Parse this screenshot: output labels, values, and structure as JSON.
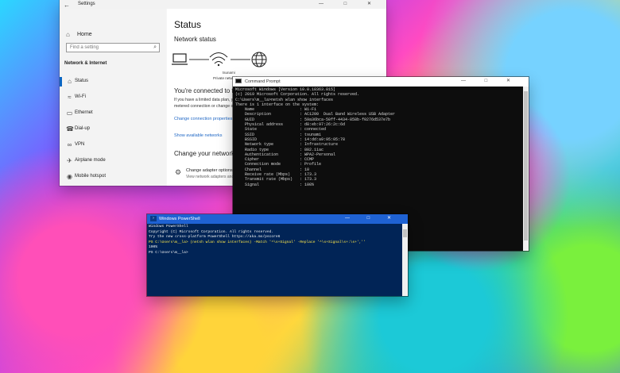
{
  "settings": {
    "window_title": "Settings",
    "back_glyph": "←",
    "controls": [
      "—",
      "□",
      "✕"
    ],
    "home_label": "Home",
    "search_placeholder": "Find a setting",
    "section_title": "Network & Internet",
    "nav_items": [
      {
        "label": "Status",
        "icon": "home-network-icon"
      },
      {
        "label": "Wi-Fi",
        "icon": "wifi-icon"
      },
      {
        "label": "Ethernet",
        "icon": "ethernet-icon"
      },
      {
        "label": "Dial-up",
        "icon": "phone-icon"
      },
      {
        "label": "VPN",
        "icon": "vpn-icon"
      },
      {
        "label": "Airplane mode",
        "icon": "airplane-icon"
      },
      {
        "label": "Mobile hotspot",
        "icon": "hotspot-icon"
      }
    ],
    "main": {
      "title": "Status",
      "network_status": "Network status",
      "network_name": "tsunami",
      "network_type": "Private network",
      "connected_text": "You're connected to the Internet",
      "limited_text": "If you have a limited data plan, you can make this network a metered connection or change other properties.",
      "change_connection": "Change connection properties",
      "show_networks": "Show available networks",
      "change_network_settings": "Change your network settings",
      "adapter_title": "Change adapter options",
      "adapter_desc": "View network adapters and change connection settings."
    }
  },
  "cmd": {
    "title": "Command Prompt",
    "controls": [
      "—",
      "□",
      "✕"
    ],
    "lines": [
      "Microsoft Windows [Version 10.0.18363.815]",
      "(c) 2019 Microsoft Corporation. All rights reserved.",
      "",
      "C:\\Users\\m__la>netsh wlan show interfaces",
      "",
      "There is 1 interface on the system:",
      "",
      "    Name                   : Wi-Fi",
      "    Description            : AC1200  Dual Band Wireless USB Adapter",
      "    GUID                   : 59a36bca-50ff-4434-858b-f0276d537e7b",
      "    Physical address       : d8:eb:97:26:2c:6d",
      "    State                  : connected",
      "    SSID                   : tsunami",
      "    BSSID                  : 14:dd:a9:95:05:78",
      "    Network type           : Infrastructure",
      "    Radio type             : 802.11ac",
      "    Authentication         : WPA2-Personal",
      "    Cipher                 : CCMP",
      "    Connection mode        : Profile",
      "    Channel                : 10",
      "    Receive rate (Mbps)    : 173.3",
      "    Transmit rate (Mbps)   : 173.3",
      "    Signal                 : 100%"
    ]
  },
  "powershell": {
    "title": "Windows PowerShell",
    "controls": [
      "—",
      "□",
      "✕"
    ],
    "lines": [
      "Windows PowerShell",
      "Copyright (C) Microsoft Corporation. All rights reserved.",
      "",
      "Try the new cross-platform PowerShell https://aka.ms/pscore6",
      "",
      "PS C:\\Users\\m__la> (netsh wlan show interfaces) -Match '^\\s+Signal' -Replace '^\\s+Signal\\s+:\\s+',''",
      "100%",
      "PS C:\\Users\\m__la>"
    ]
  }
}
